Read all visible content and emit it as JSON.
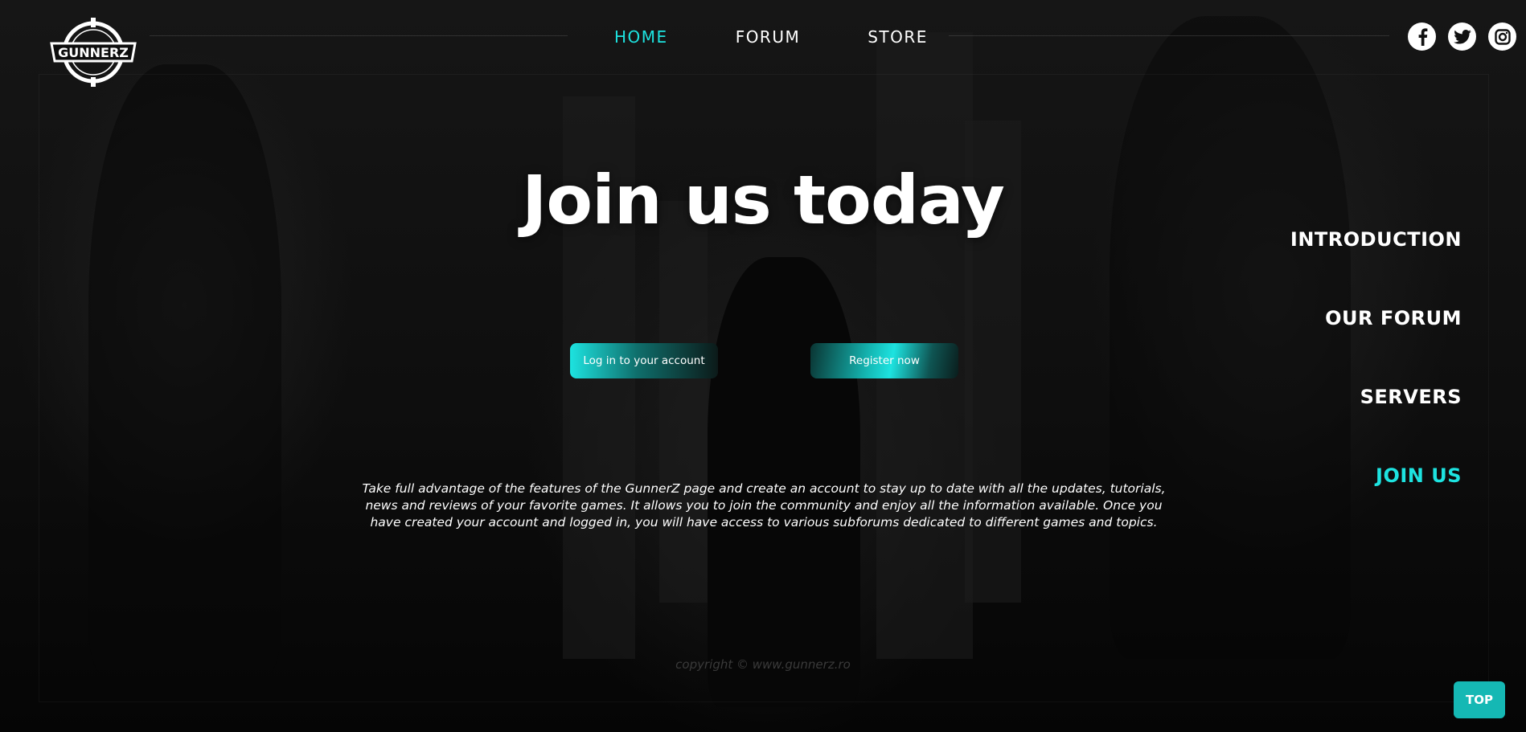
{
  "brand": {
    "logo_text": "GUNNERZ"
  },
  "nav": [
    {
      "label": "HOME",
      "active": true
    },
    {
      "label": "FORUM",
      "active": false
    },
    {
      "label": "STORE",
      "active": false
    }
  ],
  "social": [
    "facebook-icon",
    "twitter-icon",
    "instagram-icon"
  ],
  "hero": {
    "title": "Join us today",
    "login_label": "Log in to your account",
    "register_label": "Register now",
    "description": "Take full advantage of the features of the GunnerZ page and create an account to stay up to date with all the updates, tutorials, news and reviews of your favorite games. It allows you to join the community and enjoy all the information available. Once you have created your account and logged in, you will have access to various subforums dedicated to different games and topics."
  },
  "side_menu": [
    {
      "label": "INTRODUCTION",
      "active": false
    },
    {
      "label": "OUR FORUM",
      "active": false
    },
    {
      "label": "SERVERS",
      "active": false
    },
    {
      "label": "JOIN US",
      "active": true
    }
  ],
  "footer": {
    "copyright": "copyright © www.gunnerz.ro"
  },
  "top_button": {
    "label": "TOP"
  },
  "colors": {
    "accent": "#1de3e0",
    "background": "#0d0d0d",
    "text": "#ffffff"
  }
}
